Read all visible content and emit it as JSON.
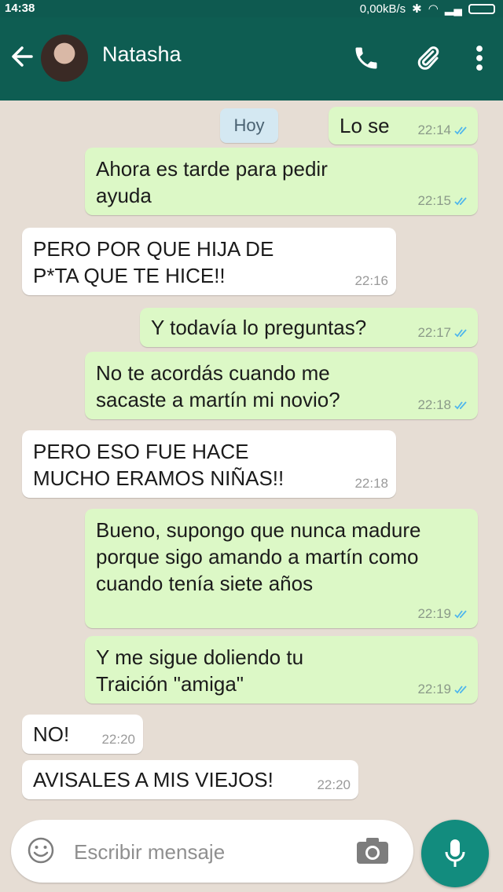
{
  "status_bar": {
    "time": "14:38",
    "network_speed": "0,00kB/s"
  },
  "header": {
    "contact_name": "Natasha",
    "icons": [
      "back-arrow-icon",
      "phone-icon",
      "paperclip-icon",
      "more-vert-icon"
    ]
  },
  "date_chip": "Hoy",
  "messages": [
    {
      "dir": "out",
      "text": "Lo se",
      "time": "22:14"
    },
    {
      "dir": "out",
      "text": "Ahora es tarde para pedir ayuda",
      "time": "22:15"
    },
    {
      "dir": "in",
      "text": "PERO POR QUE HIJA DE P*TA QUE TE HICE!!",
      "time": "22:16"
    },
    {
      "dir": "out",
      "text": "Y todavía lo preguntas?",
      "time": "22:17"
    },
    {
      "dir": "out",
      "text": "No te acordás cuando me sacaste a martín mi novio?",
      "time": "22:18"
    },
    {
      "dir": "in",
      "text": "PERO ESO FUE HACE MUCHO ERAMOS NIÑAS!!",
      "time": "22:18"
    },
    {
      "dir": "out",
      "text": "Bueno, supongo que nunca madure porque sigo amando a martín como cuando tenía siete años",
      "time": "22:19"
    },
    {
      "dir": "out",
      "text": "Y me sigue doliendo tu Traición \"amiga\"",
      "time": "22:19"
    },
    {
      "dir": "in",
      "text": "NO!",
      "time": "22:20"
    },
    {
      "dir": "in",
      "text": "AVISALES A MIS VIEJOS!",
      "time": "22:20"
    }
  ],
  "composer": {
    "placeholder": "Escribir mensaje"
  },
  "colors": {
    "header": "#0e5d52",
    "outgoing_bubble": "#dcf8c6",
    "incoming_bubble": "#ffffff",
    "chat_background": "#e6ddd4",
    "read_ticks": "#4fb6ec",
    "mic_button": "#128c7e"
  }
}
